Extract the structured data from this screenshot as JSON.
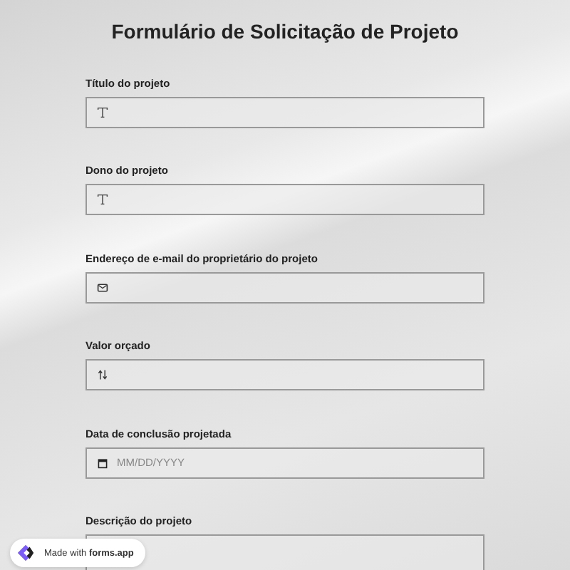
{
  "title": "Formulário de Solicitação de Projeto",
  "fields": [
    {
      "label": "Título do projeto",
      "kind": "text"
    },
    {
      "label": "Dono do projeto",
      "kind": "text"
    },
    {
      "label": "Endereço de e-mail do proprietário do projeto",
      "kind": "email"
    },
    {
      "label": "Valor orçado",
      "kind": "number"
    },
    {
      "label": "Data de conclusão projetada",
      "kind": "date",
      "placeholder": "MM/DD/YYYY"
    },
    {
      "label": "Descrição do projeto",
      "kind": "textarea"
    }
  ],
  "badge": {
    "text": "Made with **forms.app**"
  }
}
